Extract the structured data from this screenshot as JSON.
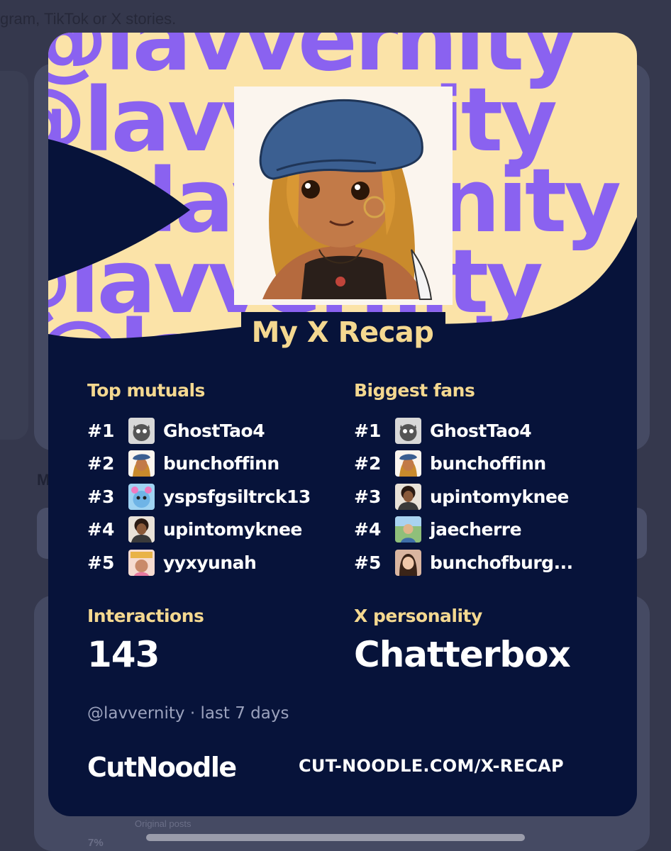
{
  "background": {
    "partial_text": "gram, TikTok or X stories.",
    "section_letter": "M",
    "original_posts_label": "Original posts",
    "percent_value": "7%"
  },
  "card": {
    "watermark_text": "@lavvernity",
    "title": "My X Recap",
    "top_mutuals": {
      "heading": "Top mutuals",
      "items": [
        {
          "rank": "#1",
          "name": "GhostTao4",
          "avatar": "gray-cat-avatar"
        },
        {
          "rank": "#2",
          "name": "bunchoffinn",
          "avatar": "anime-girl-avatar"
        },
        {
          "rank": "#3",
          "name": "yspsfgsiltrck13",
          "avatar": "blue-creature-avatar"
        },
        {
          "rank": "#4",
          "name": "upintomyknee",
          "avatar": "curly-hair-avatar"
        },
        {
          "rank": "#5",
          "name": "yyxyunah",
          "avatar": "sticker-avatar"
        }
      ]
    },
    "biggest_fans": {
      "heading": "Biggest fans",
      "items": [
        {
          "rank": "#1",
          "name": "GhostTao4",
          "avatar": "gray-cat-avatar"
        },
        {
          "rank": "#2",
          "name": "bunchoffinn",
          "avatar": "anime-girl-avatar"
        },
        {
          "rank": "#3",
          "name": "upintomyknee",
          "avatar": "curly-hair-avatar"
        },
        {
          "rank": "#4",
          "name": "jaecherre",
          "avatar": "outdoor-photo-avatar"
        },
        {
          "rank": "#5",
          "name": "bunchofburg...",
          "avatar": "portrait-photo-avatar"
        }
      ]
    },
    "interactions": {
      "label": "Interactions",
      "value": "143"
    },
    "personality": {
      "label": "X personality",
      "value": "Chatterbox"
    },
    "footer": {
      "handle_line": "@lavvernity · last 7 days",
      "brand": "CutNoodle",
      "url": "CUT-NOODLE.COM/X-RECAP"
    }
  },
  "colors": {
    "card_bg": "#07133a",
    "banner_bg": "#fbe3a8",
    "watermark": "#8a62f0",
    "accent_text": "#f4d890"
  }
}
